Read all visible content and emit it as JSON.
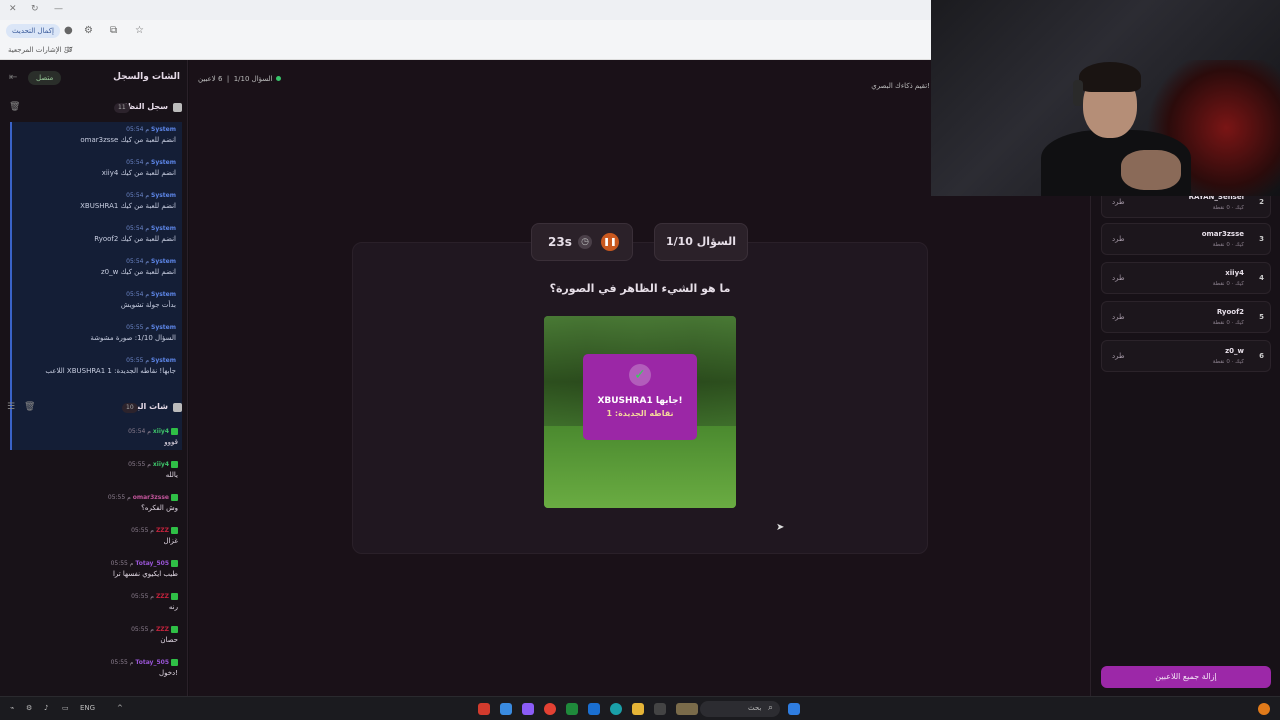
{
  "browser": {
    "update_button": "إكمال التحديث",
    "bookmarks_label": "كل الإشارات المرجعية"
  },
  "left_panel": {
    "title": "الشات والسجل",
    "status": "متصل",
    "system_log": {
      "title": "سجل النظام",
      "count": "11",
      "items": [
        {
          "user": "System",
          "time": "05:54 م",
          "message": "omar3zsse انضم للعبة من كيك"
        },
        {
          "user": "System",
          "time": "05:54 م",
          "message": "xiiy4 انضم للعبة من كيك"
        },
        {
          "user": "System",
          "time": "05:54 م",
          "message": "XBUSHRA1 انضم للعبة من كيك"
        },
        {
          "user": "System",
          "time": "05:54 م",
          "message": "Ryoof2 انضم للعبة من كيك"
        },
        {
          "user": "System",
          "time": "05:54 م",
          "message": "z0_w انضم للعبة من كيك"
        },
        {
          "user": "System",
          "time": "05:54 م",
          "message": "بدأت جولة تشويش"
        },
        {
          "user": "System",
          "time": "05:55 م",
          "message": "السؤال 1/10: صورة مشوشة"
        },
        {
          "user": "System",
          "time": "05:55 م",
          "message": "اللاعب XBUSHRA1 جابها! نقاطه الجديدة: 1"
        }
      ]
    },
    "chat": {
      "title": "شات البث",
      "count": "10",
      "items": [
        {
          "user": "xiiy4",
          "color": "#3ec46a",
          "time": "05:54 م",
          "message": "قووو"
        },
        {
          "user": "xiiy4",
          "color": "#3ec46a",
          "time": "05:55 م",
          "message": "يالله"
        },
        {
          "user": "omar3zsse",
          "color": "#c2559b",
          "time": "05:55 م",
          "message": "وش الفكره؟"
        },
        {
          "user": "ZZZ",
          "color": "#c2223c",
          "time": "05:55 م",
          "message": "غزال"
        },
        {
          "user": "Totay_505",
          "color": "#9a55d8",
          "time": "05:55 م",
          "message": "طيب ايكيوي نفسها ترا"
        },
        {
          "user": "ZZZ",
          "color": "#c2223c",
          "time": "05:55 م",
          "message": "رنه"
        },
        {
          "user": "ZZZ",
          "color": "#c2223c",
          "time": "05:55 م",
          "message": "حصان"
        },
        {
          "user": "Totay_505",
          "color": "#9a55d8",
          "time": "05:55 م",
          "message": "دخول!"
        }
      ]
    }
  },
  "main": {
    "players_count": "6 لاعبين",
    "question_progress": "السؤال 1/10",
    "topbar_right": "تقيم ذكاءك البصري!",
    "question_pill": "السؤال 1/10",
    "timer": "23s",
    "question": "ما هو الشيء الظاهر في الصورة؟",
    "answer": {
      "name": "XBUSHRA1 جابها!",
      "points": "نقاطه الجديدة: 1"
    }
  },
  "players": {
    "kick_label": "طرد",
    "meta": "كيك · 0 نقطة",
    "list": [
      {
        "rank": "2",
        "name": "RAYAN_Sensei"
      },
      {
        "rank": "3",
        "name": "omar3zsse"
      },
      {
        "rank": "4",
        "name": "xiiy4"
      },
      {
        "rank": "5",
        "name": "Ryoof2"
      },
      {
        "rank": "6",
        "name": "z0_w"
      }
    ],
    "remove_all": "إزالة جميع اللاعبين"
  },
  "taskbar": {
    "lang": "ENG",
    "search_placeholder": "بحث"
  }
}
